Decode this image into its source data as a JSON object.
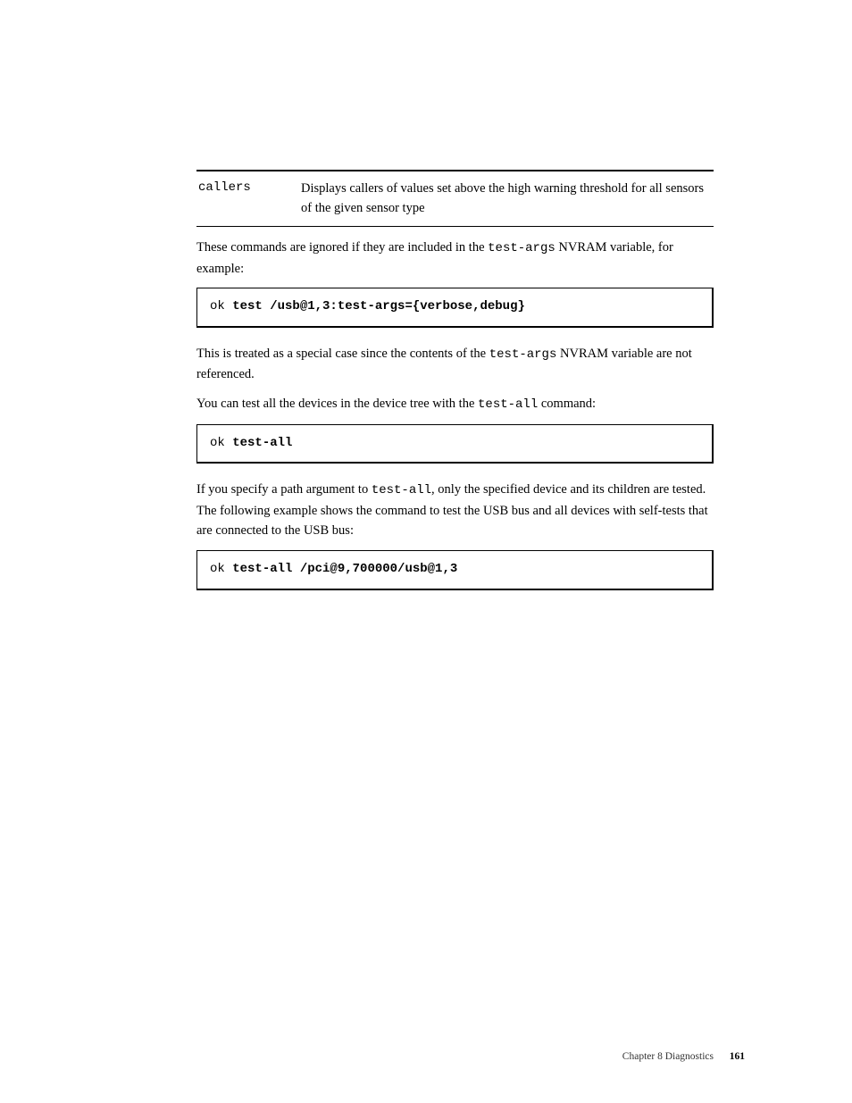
{
  "table": {
    "col1": "callers",
    "col2": "Displays callers of values set above the high warning threshold for all sensors of the given sensor type"
  },
  "para1": {
    "t1": "These commands are ignored if they are included in the ",
    "code1": "test-args",
    "t2": " NVRAM variable, for example:"
  },
  "code1": {
    "prompt": "ok ",
    "cmd": "test /usb@1,3:test-args={verbose,debug}"
  },
  "para2": {
    "t1": "This is treated as a special case since the contents of the ",
    "code1": "test-args",
    "t2": " NVRAM variable are not referenced."
  },
  "para3": {
    "t1": "You can test all the devices in the device tree with the ",
    "code1": "test-all",
    "t2": " command:"
  },
  "code2": {
    "prompt": "ok ",
    "cmd": "test-all"
  },
  "para4": {
    "t1": "If you specify a path argument to ",
    "code1": "test-all",
    "t2": ", only the specified device and its children are tested. The following example shows the command to test the USB bus and all devices with self-tests that are connected to the USB bus:"
  },
  "code3": {
    "prompt": "ok ",
    "cmd": "test-all /pci@9,700000/usb@1,3"
  },
  "footer": {
    "chapter": "Chapter 8 Diagnostics",
    "pagenum": "161"
  }
}
